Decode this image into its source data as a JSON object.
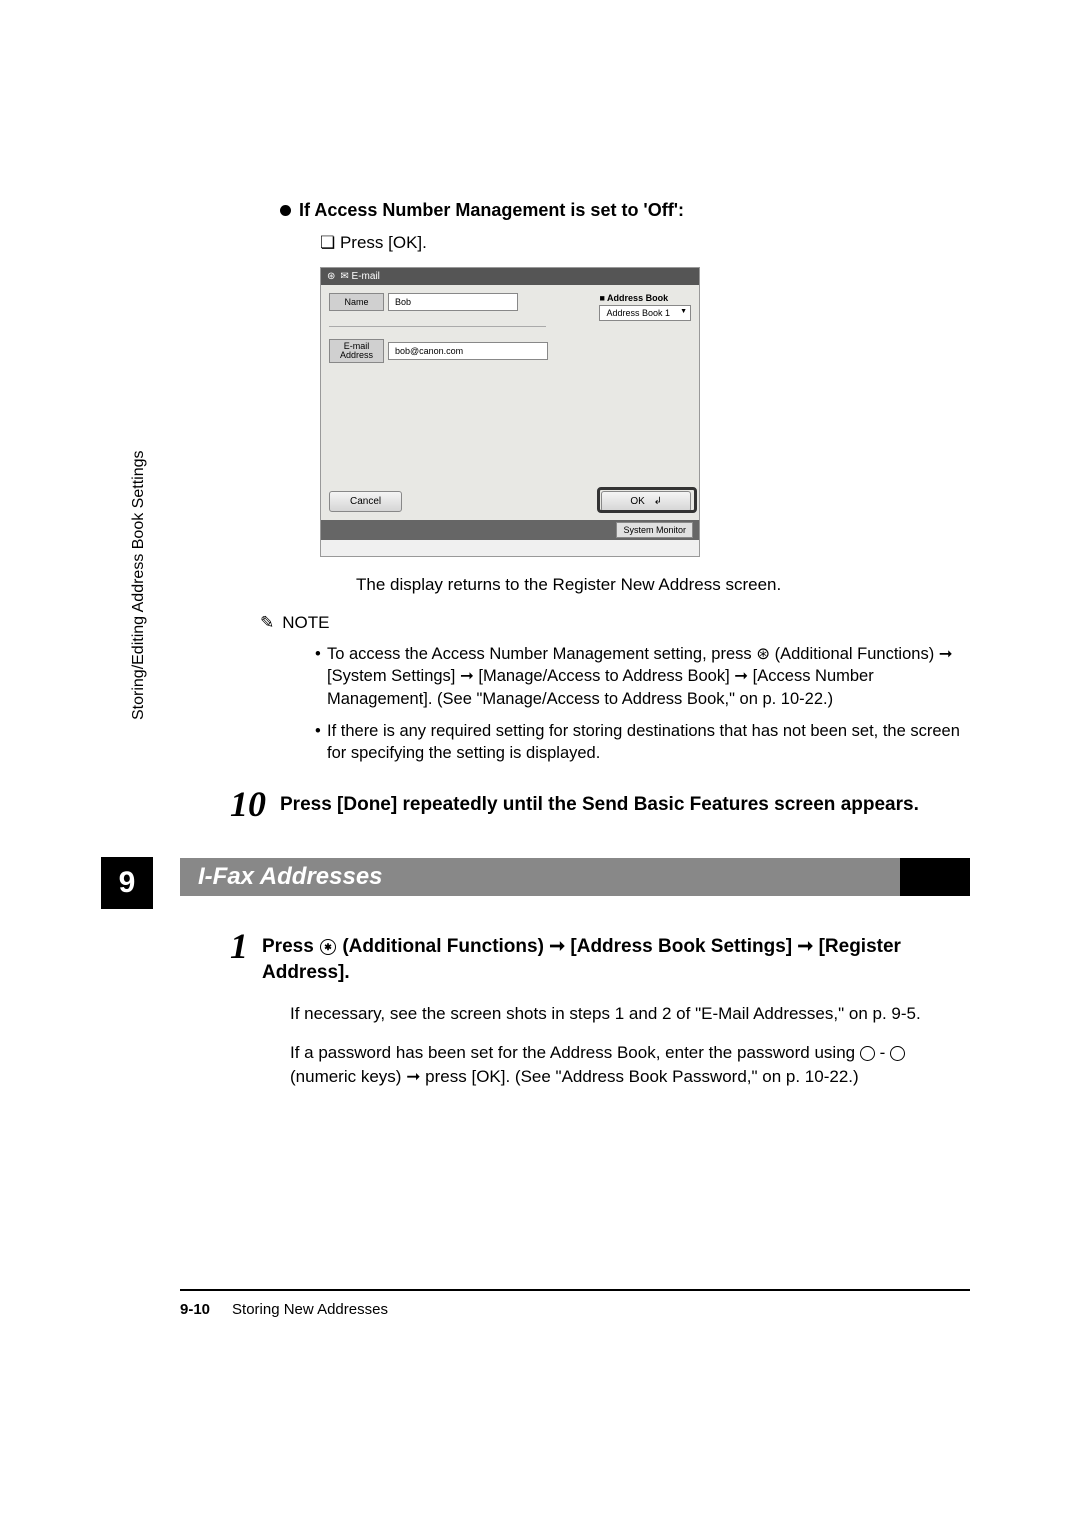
{
  "heading_off": "If Access Number Management is set to 'Off':",
  "press_ok": "Press [OK].",
  "screenshot": {
    "titlebar": "✉  E-mail",
    "name_label": "Name",
    "name_value": "Bob",
    "addressbook_heading": "■ Address Book",
    "addressbook_value": "Address Book 1",
    "email_label": "E-mail\nAddress",
    "email_value": "bob@canon.com",
    "cancel_btn": "Cancel",
    "ok_btn": "OK",
    "system_monitor": "System Monitor"
  },
  "caption_return": "The display returns to the Register New Address screen.",
  "note_label": "NOTE",
  "note1": "To access the Access Number Management setting, press ⊛ (Additional Functions) ➞ [System Settings] ➞ [Manage/Access to Address Book] ➞ [Access Number Management]. (See \"Manage/Access to Address Book,\" on p. 10-22.)",
  "note2": "If there is any required setting for storing destinations that has not been set, the screen for specifying the setting is displayed.",
  "step10_num": "10",
  "step10_text": "Press [Done] repeatedly until the Send Basic Features screen appears.",
  "section_title": "I-Fax Addresses",
  "step1_num": "1",
  "step1_prefix": "Press ",
  "step1_after_icon": " (Additional Functions) ",
  "step1_arrow1_after": " [Address Book Settings] ",
  "step1_arrow2_after": " [Register Address].",
  "body1": "If necessary, see the screen shots in steps 1 and 2 of \"E-Mail Addresses,\" on p. 9-5.",
  "body2_prefix": "If a password has been set for the Address Book, enter the password using ",
  "body2_between": " - ",
  "body2_after": " (numeric keys) ",
  "body2_end": " press [OK]. (See \"Address Book Password,\" on p. 10-22.)",
  "sidebar": "Storing/Editing Address Book Settings",
  "chapter": "9",
  "footer_page": "9-10",
  "footer_title": "Storing New Addresses"
}
